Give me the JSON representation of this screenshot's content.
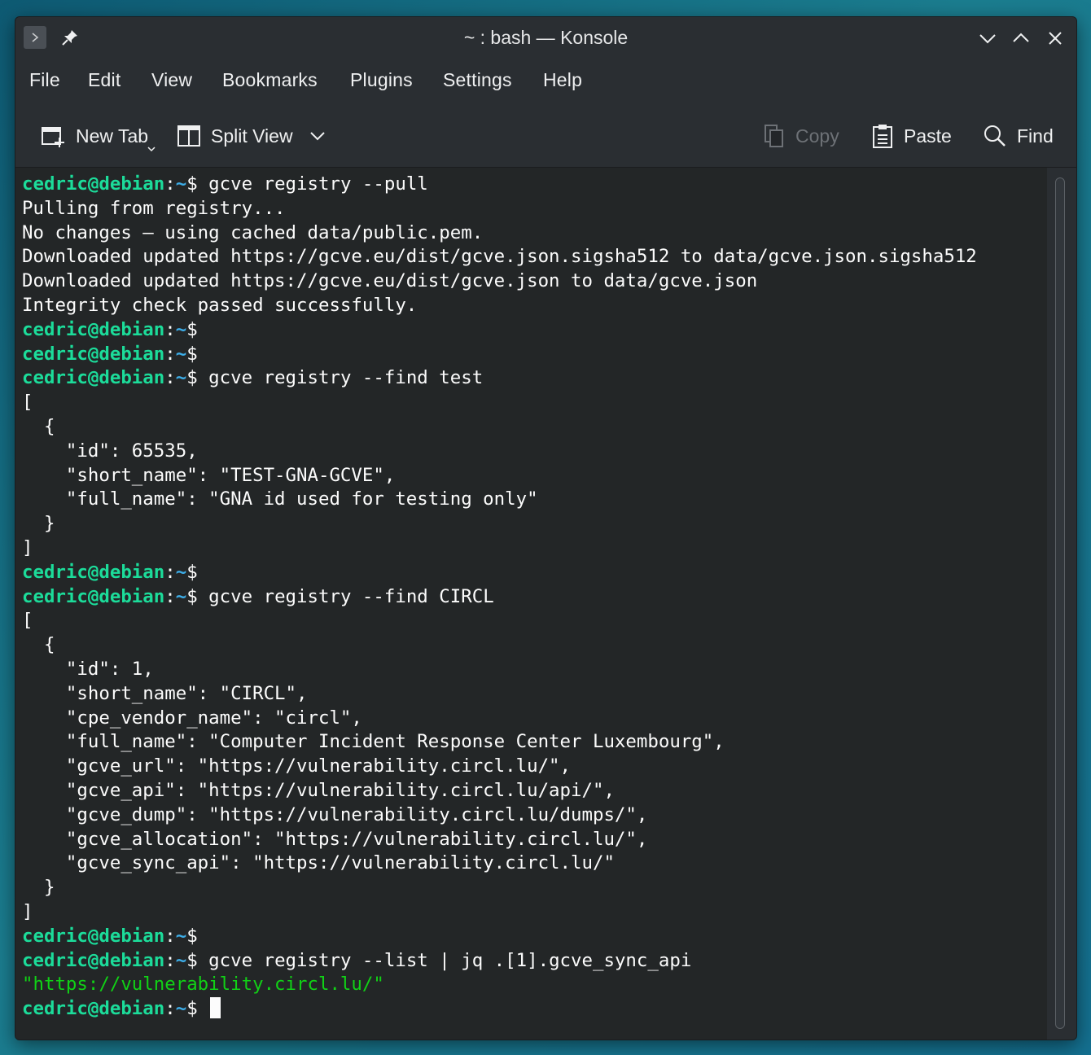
{
  "window": {
    "title": "~ : bash — Konsole"
  },
  "menu": [
    "File",
    "Edit",
    "View",
    "Bookmarks",
    "Plugins",
    "Settings",
    "Help"
  ],
  "toolbar": {
    "new_tab": "New Tab",
    "split_view": "Split View",
    "copy": "Copy",
    "paste": "Paste",
    "find": "Find"
  },
  "prompt": {
    "user": "cedric@debian",
    "colon": ":",
    "dir": "~",
    "symbol": "$"
  },
  "terminal": [
    {
      "prompt": true,
      "cmd": " gcve registry --pull"
    },
    {
      "text": "Pulling from registry..."
    },
    {
      "text": "No changes – using cached data/public.pem."
    },
    {
      "text": "Downloaded updated https://gcve.eu/dist/gcve.json.sigsha512 to data/gcve.json.sigsha512"
    },
    {
      "text": "Downloaded updated https://gcve.eu/dist/gcve.json to data/gcve.json"
    },
    {
      "text": "Integrity check passed successfully."
    },
    {
      "prompt": true,
      "cmd": ""
    },
    {
      "prompt": true,
      "cmd": ""
    },
    {
      "prompt": true,
      "cmd": " gcve registry --find test"
    },
    {
      "text": "["
    },
    {
      "text": "  {"
    },
    {
      "text": "    \"id\": 65535,"
    },
    {
      "text": "    \"short_name\": \"TEST-GNA-GCVE\","
    },
    {
      "text": "    \"full_name\": \"GNA id used for testing only\""
    },
    {
      "text": "  }"
    },
    {
      "text": "]"
    },
    {
      "prompt": true,
      "cmd": ""
    },
    {
      "prompt": true,
      "cmd": " gcve registry --find CIRCL"
    },
    {
      "text": "["
    },
    {
      "text": "  {"
    },
    {
      "text": "    \"id\": 1,"
    },
    {
      "text": "    \"short_name\": \"CIRCL\","
    },
    {
      "text": "    \"cpe_vendor_name\": \"circl\","
    },
    {
      "text": "    \"full_name\": \"Computer Incident Response Center Luxembourg\","
    },
    {
      "text": "    \"gcve_url\": \"https://vulnerability.circl.lu/\","
    },
    {
      "text": "    \"gcve_api\": \"https://vulnerability.circl.lu/api/\","
    },
    {
      "text": "    \"gcve_dump\": \"https://vulnerability.circl.lu/dumps/\","
    },
    {
      "text": "    \"gcve_allocation\": \"https://vulnerability.circl.lu/\","
    },
    {
      "text": "    \"gcve_sync_api\": \"https://vulnerability.circl.lu/\""
    },
    {
      "text": "  }"
    },
    {
      "text": "]"
    },
    {
      "prompt": true,
      "cmd": ""
    },
    {
      "prompt": true,
      "cmd": " gcve registry --list | jq .[1].gcve_sync_api"
    },
    {
      "text": "\"https://vulnerability.circl.lu/\"",
      "style": "str"
    },
    {
      "prompt": true,
      "cmd": " ",
      "cursor": true
    }
  ]
}
